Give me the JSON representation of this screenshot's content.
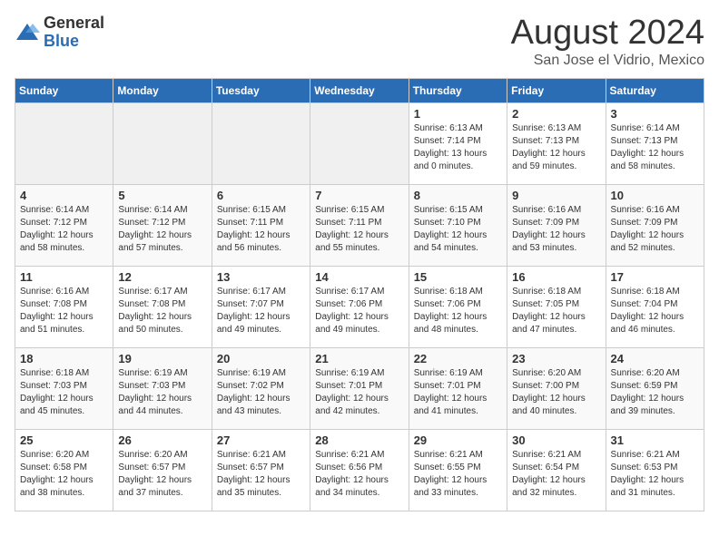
{
  "header": {
    "logo_general": "General",
    "logo_blue": "Blue",
    "month_title": "August 2024",
    "location": "San Jose el Vidrio, Mexico"
  },
  "weekdays": [
    "Sunday",
    "Monday",
    "Tuesday",
    "Wednesday",
    "Thursday",
    "Friday",
    "Saturday"
  ],
  "weeks": [
    [
      {
        "day": "",
        "info": ""
      },
      {
        "day": "",
        "info": ""
      },
      {
        "day": "",
        "info": ""
      },
      {
        "day": "",
        "info": ""
      },
      {
        "day": "1",
        "info": "Sunrise: 6:13 AM\nSunset: 7:14 PM\nDaylight: 13 hours\nand 0 minutes."
      },
      {
        "day": "2",
        "info": "Sunrise: 6:13 AM\nSunset: 7:13 PM\nDaylight: 12 hours\nand 59 minutes."
      },
      {
        "day": "3",
        "info": "Sunrise: 6:14 AM\nSunset: 7:13 PM\nDaylight: 12 hours\nand 58 minutes."
      }
    ],
    [
      {
        "day": "4",
        "info": "Sunrise: 6:14 AM\nSunset: 7:12 PM\nDaylight: 12 hours\nand 58 minutes."
      },
      {
        "day": "5",
        "info": "Sunrise: 6:14 AM\nSunset: 7:12 PM\nDaylight: 12 hours\nand 57 minutes."
      },
      {
        "day": "6",
        "info": "Sunrise: 6:15 AM\nSunset: 7:11 PM\nDaylight: 12 hours\nand 56 minutes."
      },
      {
        "day": "7",
        "info": "Sunrise: 6:15 AM\nSunset: 7:11 PM\nDaylight: 12 hours\nand 55 minutes."
      },
      {
        "day": "8",
        "info": "Sunrise: 6:15 AM\nSunset: 7:10 PM\nDaylight: 12 hours\nand 54 minutes."
      },
      {
        "day": "9",
        "info": "Sunrise: 6:16 AM\nSunset: 7:09 PM\nDaylight: 12 hours\nand 53 minutes."
      },
      {
        "day": "10",
        "info": "Sunrise: 6:16 AM\nSunset: 7:09 PM\nDaylight: 12 hours\nand 52 minutes."
      }
    ],
    [
      {
        "day": "11",
        "info": "Sunrise: 6:16 AM\nSunset: 7:08 PM\nDaylight: 12 hours\nand 51 minutes."
      },
      {
        "day": "12",
        "info": "Sunrise: 6:17 AM\nSunset: 7:08 PM\nDaylight: 12 hours\nand 50 minutes."
      },
      {
        "day": "13",
        "info": "Sunrise: 6:17 AM\nSunset: 7:07 PM\nDaylight: 12 hours\nand 49 minutes."
      },
      {
        "day": "14",
        "info": "Sunrise: 6:17 AM\nSunset: 7:06 PM\nDaylight: 12 hours\nand 49 minutes."
      },
      {
        "day": "15",
        "info": "Sunrise: 6:18 AM\nSunset: 7:06 PM\nDaylight: 12 hours\nand 48 minutes."
      },
      {
        "day": "16",
        "info": "Sunrise: 6:18 AM\nSunset: 7:05 PM\nDaylight: 12 hours\nand 47 minutes."
      },
      {
        "day": "17",
        "info": "Sunrise: 6:18 AM\nSunset: 7:04 PM\nDaylight: 12 hours\nand 46 minutes."
      }
    ],
    [
      {
        "day": "18",
        "info": "Sunrise: 6:18 AM\nSunset: 7:03 PM\nDaylight: 12 hours\nand 45 minutes."
      },
      {
        "day": "19",
        "info": "Sunrise: 6:19 AM\nSunset: 7:03 PM\nDaylight: 12 hours\nand 44 minutes."
      },
      {
        "day": "20",
        "info": "Sunrise: 6:19 AM\nSunset: 7:02 PM\nDaylight: 12 hours\nand 43 minutes."
      },
      {
        "day": "21",
        "info": "Sunrise: 6:19 AM\nSunset: 7:01 PM\nDaylight: 12 hours\nand 42 minutes."
      },
      {
        "day": "22",
        "info": "Sunrise: 6:19 AM\nSunset: 7:01 PM\nDaylight: 12 hours\nand 41 minutes."
      },
      {
        "day": "23",
        "info": "Sunrise: 6:20 AM\nSunset: 7:00 PM\nDaylight: 12 hours\nand 40 minutes."
      },
      {
        "day": "24",
        "info": "Sunrise: 6:20 AM\nSunset: 6:59 PM\nDaylight: 12 hours\nand 39 minutes."
      }
    ],
    [
      {
        "day": "25",
        "info": "Sunrise: 6:20 AM\nSunset: 6:58 PM\nDaylight: 12 hours\nand 38 minutes."
      },
      {
        "day": "26",
        "info": "Sunrise: 6:20 AM\nSunset: 6:57 PM\nDaylight: 12 hours\nand 37 minutes."
      },
      {
        "day": "27",
        "info": "Sunrise: 6:21 AM\nSunset: 6:57 PM\nDaylight: 12 hours\nand 35 minutes."
      },
      {
        "day": "28",
        "info": "Sunrise: 6:21 AM\nSunset: 6:56 PM\nDaylight: 12 hours\nand 34 minutes."
      },
      {
        "day": "29",
        "info": "Sunrise: 6:21 AM\nSunset: 6:55 PM\nDaylight: 12 hours\nand 33 minutes."
      },
      {
        "day": "30",
        "info": "Sunrise: 6:21 AM\nSunset: 6:54 PM\nDaylight: 12 hours\nand 32 minutes."
      },
      {
        "day": "31",
        "info": "Sunrise: 6:21 AM\nSunset: 6:53 PM\nDaylight: 12 hours\nand 31 minutes."
      }
    ]
  ]
}
